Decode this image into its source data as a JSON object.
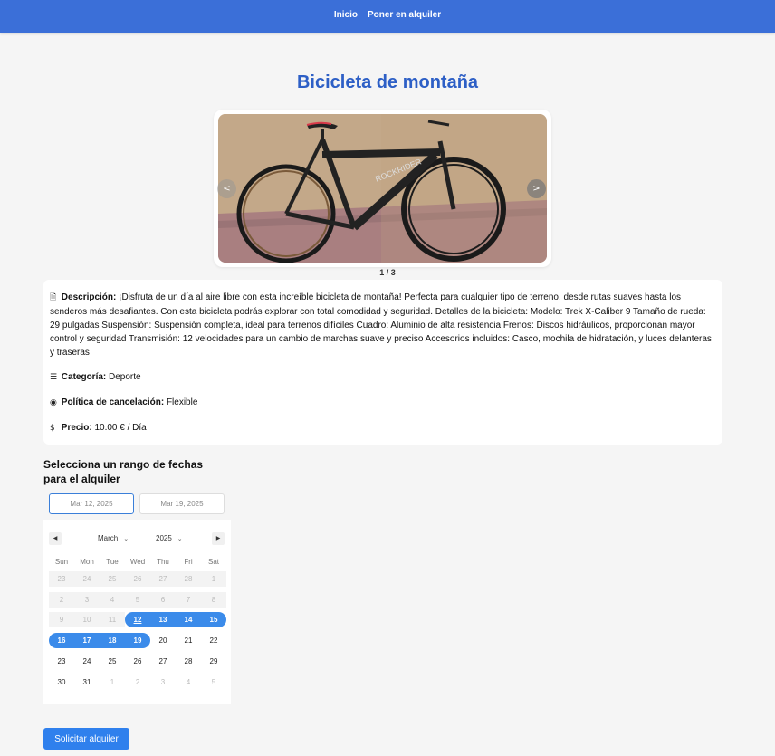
{
  "nav": {
    "links": [
      {
        "label": "Inicio"
      },
      {
        "label": "Poner en alquiler"
      }
    ]
  },
  "listing": {
    "title": "Bicicleta de montaña",
    "carousel": {
      "counter": "1 / 3",
      "prev_label": "<",
      "next_label": ">"
    },
    "description_label": "Descripción:",
    "description": "¡Disfruta de un día al aire libre con esta increíble bicicleta de montaña! Perfecta para cualquier tipo de terreno, desde rutas suaves hasta los senderos más desafiantes. Con esta bicicleta podrás explorar con total comodidad y seguridad. Detalles de la bicicleta: Modelo: Trek X-Caliber 9 Tamaño de rueda: 29 pulgadas Suspensión: Suspensión completa, ideal para terrenos difíciles Cuadro: Aluminio de alta resistencia Frenos: Discos hidráulicos, proporcionan mayor control y seguridad Transmisión: 12 velocidades para un cambio de marchas suave y preciso Accesorios incluidos: Casco, mochila de hidratación, y luces delanteras y traseras",
    "category_label": "Categoría:",
    "category": "Deporte",
    "policy_label": "Política de cancelación:",
    "policy": "Flexible",
    "price_label": "Precio:",
    "price": "10.00 € / Día"
  },
  "booking": {
    "heading": "Selecciona un rango de fechas para el alquiler",
    "start_date": "Mar 12, 2025",
    "end_date": "Mar 19, 2025",
    "calendar": {
      "month": "March",
      "year": "2025",
      "weekdays": [
        "Sun",
        "Mon",
        "Tue",
        "Wed",
        "Thu",
        "Fri",
        "Sat"
      ],
      "weeks": [
        [
          {
            "d": "23",
            "m": 1
          },
          {
            "d": "24",
            "m": 1
          },
          {
            "d": "25",
            "m": 1
          },
          {
            "d": "26",
            "m": 1
          },
          {
            "d": "27",
            "m": 1
          },
          {
            "d": "28",
            "m": 1
          },
          {
            "d": "1",
            "m": 1
          }
        ],
        [
          {
            "d": "2",
            "m": 1
          },
          {
            "d": "3",
            "m": 1
          },
          {
            "d": "4",
            "m": 1
          },
          {
            "d": "5",
            "m": 1
          },
          {
            "d": "6",
            "m": 1
          },
          {
            "d": "7",
            "m": 1
          },
          {
            "d": "8",
            "m": 1
          }
        ],
        [
          {
            "d": "9",
            "m": 1
          },
          {
            "d": "10",
            "m": 1
          },
          {
            "d": "11",
            "m": 1
          },
          {
            "d": "12",
            "s": 1,
            "t": 1
          },
          {
            "d": "13",
            "s": 1
          },
          {
            "d": "14",
            "s": 1
          },
          {
            "d": "15",
            "s": 1
          }
        ],
        [
          {
            "d": "16",
            "s": 1
          },
          {
            "d": "17",
            "s": 1
          },
          {
            "d": "18",
            "s": 1
          },
          {
            "d": "19",
            "s": 1
          },
          {
            "d": "20"
          },
          {
            "d": "21"
          },
          {
            "d": "22"
          }
        ],
        [
          {
            "d": "23"
          },
          {
            "d": "24"
          },
          {
            "d": "25"
          },
          {
            "d": "26"
          },
          {
            "d": "27"
          },
          {
            "d": "28"
          },
          {
            "d": "29"
          }
        ],
        [
          {
            "d": "30"
          },
          {
            "d": "31"
          },
          {
            "d": "1",
            "m": 1
          },
          {
            "d": "2",
            "m": 1
          },
          {
            "d": "3",
            "m": 1
          },
          {
            "d": "4",
            "m": 1
          },
          {
            "d": "5",
            "m": 1
          }
        ]
      ]
    },
    "submit_label": "Solicitar alquiler"
  },
  "colors": {
    "navbar": "#3b6fd8",
    "title": "#2d5fc6",
    "selection": "#3b8bea",
    "button": "#2f80ed"
  }
}
